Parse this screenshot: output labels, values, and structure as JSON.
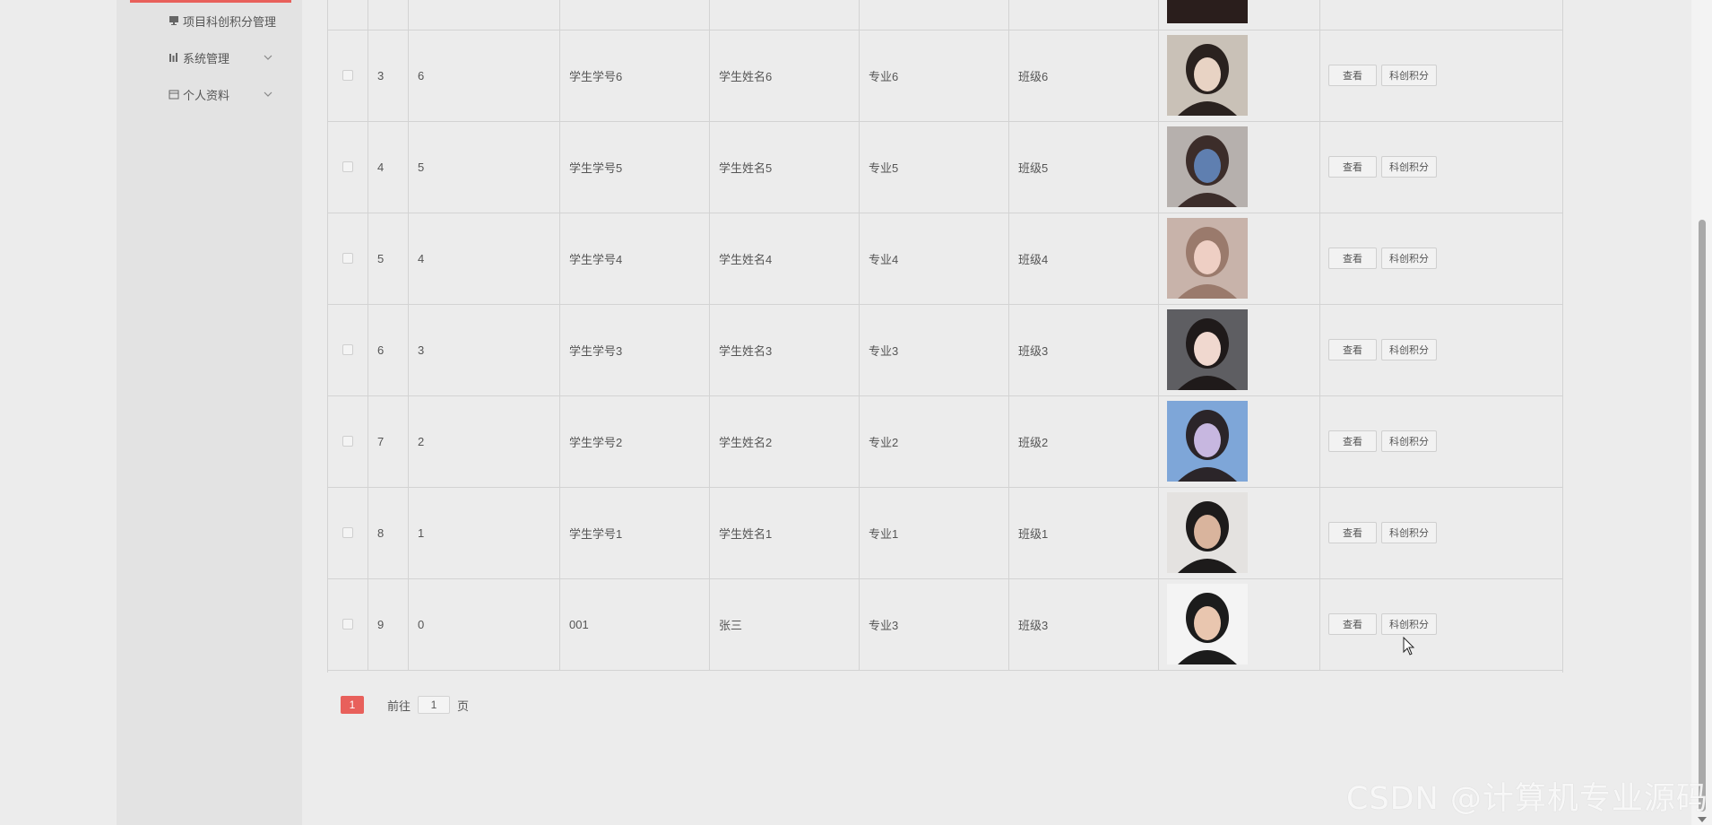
{
  "sidebar": {
    "items": [
      {
        "label": "项目科创积分管理",
        "icon": "monitor-icon"
      },
      {
        "label": "系统管理",
        "icon": "bar-chart-icon"
      },
      {
        "label": "个人资料",
        "icon": "calendar-icon"
      }
    ]
  },
  "table": {
    "rows": [
      {
        "index": "3",
        "id": "6",
        "student_no": "学生学号6",
        "name": "学生姓名6",
        "major": "专业6",
        "class": "班级6",
        "photo": "portrait-girl-short-hair",
        "photo_colors": [
          "#c9c1b7",
          "#2a221f",
          "#e8d3c4"
        ]
      },
      {
        "index": "4",
        "id": "5",
        "student_no": "学生学号5",
        "name": "学生姓名5",
        "major": "专业5",
        "class": "班级5",
        "photo": "portrait-girl-plaid-coat",
        "photo_colors": [
          "#b6b0ad",
          "#3c2d2a",
          "#5f7fb0"
        ]
      },
      {
        "index": "5",
        "id": "4",
        "student_no": "学生学号4",
        "name": "学生姓名4",
        "major": "专业4",
        "class": "班级4",
        "photo": "portrait-girl-light-hair",
        "photo_colors": [
          "#c8b3aa",
          "#9a7a6c",
          "#eecfc4"
        ]
      },
      {
        "index": "6",
        "id": "3",
        "student_no": "学生学号3",
        "name": "学生姓名3",
        "major": "专业3",
        "class": "班级3",
        "photo": "portrait-girl-dark-hair",
        "photo_colors": [
          "#5e5e62",
          "#1f1a1a",
          "#f0d8cf"
        ]
      },
      {
        "index": "7",
        "id": "2",
        "student_no": "学生学号2",
        "name": "学生姓名2",
        "major": "专业2",
        "class": "班级2",
        "photo": "portrait-girl-blue-sky",
        "photo_colors": [
          "#7ea6d8",
          "#2b2529",
          "#c7b7e0"
        ]
      },
      {
        "index": "8",
        "id": "1",
        "student_no": "学生学号1",
        "name": "学生姓名1",
        "major": "专业1",
        "class": "班级1",
        "photo": "portrait-boy-cap",
        "photo_colors": [
          "#e4e2e0",
          "#1d1b1b",
          "#d9b49d"
        ]
      },
      {
        "index": "9",
        "id": "0",
        "student_no": "001",
        "name": "张三",
        "major": "专业3",
        "class": "班级3",
        "photo": "portrait-man-black-tee",
        "photo_colors": [
          "#f4f4f4",
          "#1c1c1c",
          "#e9c6af"
        ]
      }
    ],
    "actions": {
      "view": "查看",
      "score": "科创积分"
    }
  },
  "pagination": {
    "current": "1",
    "goto_label": "前往",
    "goto_value": "1",
    "unit": "页"
  },
  "watermark": "CSDN @计算机专业源码",
  "colors": {
    "accent": "#e8605b",
    "background": "#ececec",
    "sidebar": "#e3e3e3"
  }
}
